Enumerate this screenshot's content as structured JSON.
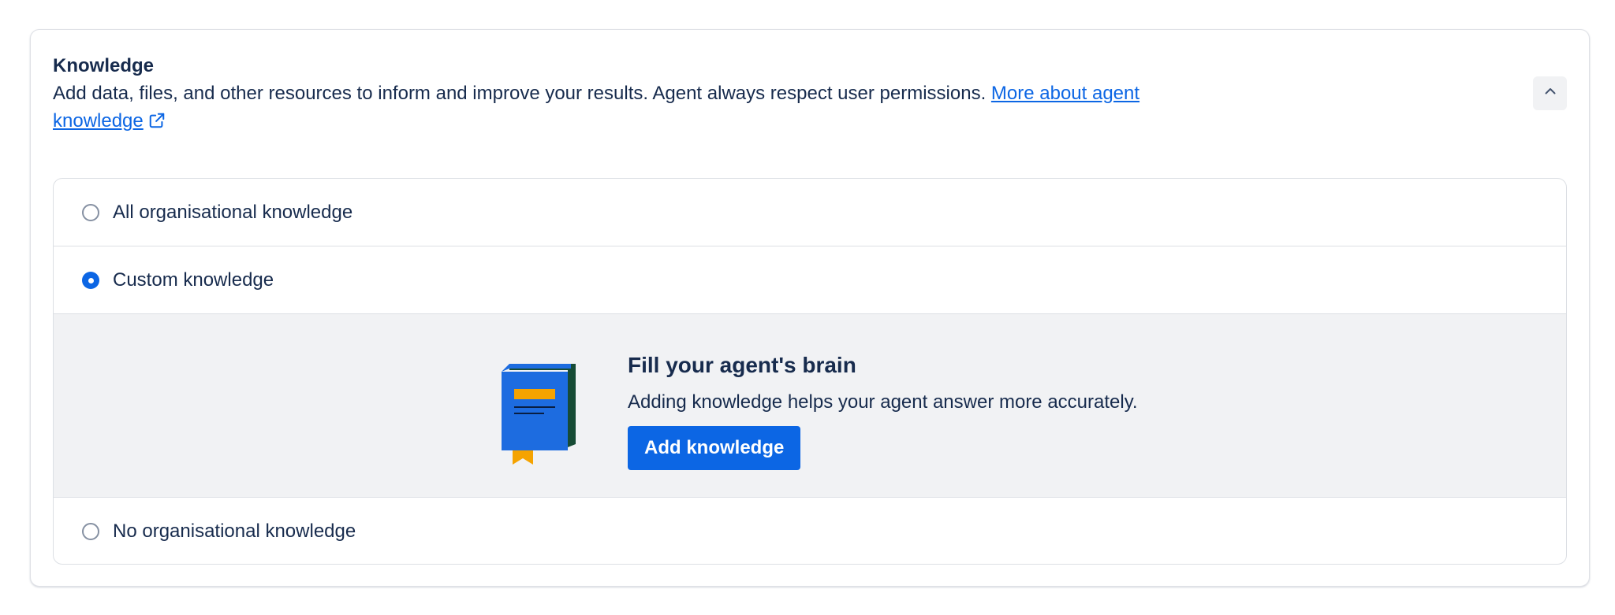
{
  "knowledge": {
    "title": "Knowledge",
    "description": "Add data, files, and other resources to inform and improve your results. Agent always respect user permissions. ",
    "link_text": "More about agent knowledge",
    "options": [
      {
        "label": "All organisational knowledge",
        "selected": false
      },
      {
        "label": "Custom knowledge",
        "selected": true
      },
      {
        "label": "No organisational knowledge",
        "selected": false
      }
    ],
    "empty_state": {
      "title": "Fill your agent's brain",
      "description": "Adding knowledge helps your agent answer more accurately.",
      "button_label": "Add knowledge",
      "illustration": "book-icon"
    },
    "collapse_icon": "chevron-up-icon",
    "link_icon": "external-link-icon"
  },
  "colors": {
    "accent": "#0c66e4",
    "text": "#172b4d",
    "panel_bg": "#f1f2f4",
    "border": "#dcdfe4",
    "book_blue": "#1d6ce0",
    "book_spine": "#164b35",
    "book_yellow": "#f5a300"
  }
}
